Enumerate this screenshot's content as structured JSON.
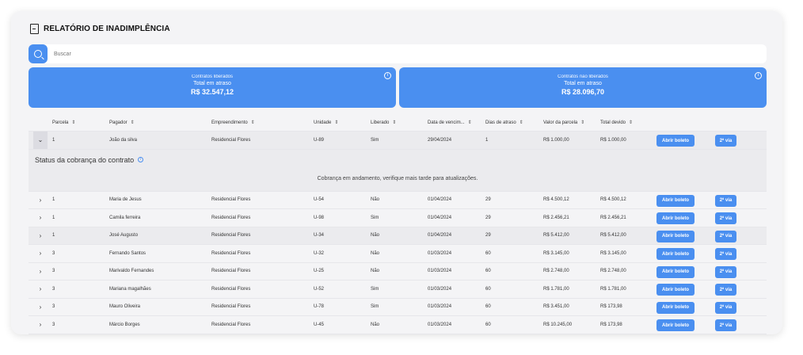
{
  "header": {
    "title": "RELATÓRIO DE INADIMPLÊNCIA",
    "icon": "document-icon"
  },
  "search": {
    "placeholder": "Buscar"
  },
  "kpis": [
    {
      "label": "Contratos liberados",
      "sublabel": "Total em atraso",
      "value": "R$ 32.547,12"
    },
    {
      "label": "Contratos não liberados",
      "sublabel": "Total em atraso",
      "value": "R$ 28.096,70"
    }
  ],
  "table": {
    "columns": [
      "Parcela",
      "Pagador",
      "Empreendimento",
      "Unidade",
      "Liberado",
      "Data de vencim...",
      "Dias de atraso",
      "Valor da parcela",
      "Total devido"
    ],
    "buttons": {
      "boleto": "Abrir boleto",
      "via": "2ª via"
    },
    "expanded": {
      "parcela": "1",
      "pagador": "João da silva",
      "empreendimento": "Residencial Flores",
      "unidade": "U-89",
      "liberado": "Sim",
      "vencimento": "29/04/2024",
      "dias": "1",
      "valor": "R$ 1.000,00",
      "total": "R$ 1.000,00"
    },
    "status": {
      "title": "Status da cobrança do contrato",
      "message": "Cobrança em andamento, verifique mais tarde para atualizações."
    },
    "rows": [
      {
        "parcela": "1",
        "pagador": "Maria de Jesus",
        "empreendimento": "Residencial Flores",
        "unidade": "U-54",
        "liberado": "Não",
        "vencimento": "01/04/2024",
        "dias": "29",
        "valor": "R$ 4.500,12",
        "total": "R$ 4.500,12"
      },
      {
        "parcela": "1",
        "pagador": "Camila ferreira",
        "empreendimento": "Residencial Flores",
        "unidade": "U-98",
        "liberado": "Sim",
        "vencimento": "01/04/2024",
        "dias": "29",
        "valor": "R$ 2.456,21",
        "total": "R$ 2.456,21"
      },
      {
        "parcela": "1",
        "pagador": "José Augusto",
        "empreendimento": "Residencial Flores",
        "unidade": "U-34",
        "liberado": "Não",
        "vencimento": "01/04/2024",
        "dias": "29",
        "valor": "R$ 5.412,00",
        "total": "R$ 5.412,00"
      },
      {
        "parcela": "3",
        "pagador": "Fernando Santos",
        "empreendimento": "Residencial Flores",
        "unidade": "U-32",
        "liberado": "Não",
        "vencimento": "01/03/2024",
        "dias": "60",
        "valor": "R$ 3.145,00",
        "total": "R$ 3.145,00"
      },
      {
        "parcela": "3",
        "pagador": "Marivaldo Fernandes",
        "empreendimento": "Residencial Flores",
        "unidade": "U-25",
        "liberado": "Não",
        "vencimento": "01/03/2024",
        "dias": "60",
        "valor": "R$ 2.748,00",
        "total": "R$ 2.748,00"
      },
      {
        "parcela": "3",
        "pagador": "Mariana magalhães",
        "empreendimento": "Residencial Flores",
        "unidade": "U-52",
        "liberado": "Sim",
        "vencimento": "01/03/2024",
        "dias": "60",
        "valor": "R$ 1.781,00",
        "total": "R$ 1.781,00"
      },
      {
        "parcela": "3",
        "pagador": "Mauro Oliveira",
        "empreendimento": "Residencial Flores",
        "unidade": "U-78",
        "liberado": "Sim",
        "vencimento": "01/03/2024",
        "dias": "60",
        "valor": "R$ 3.451,00",
        "total": "R$ 173,98"
      },
      {
        "parcela": "3",
        "pagador": "Márcio Borges",
        "empreendimento": "Residencial Flores",
        "unidade": "U-45",
        "liberado": "Não",
        "vencimento": "01/03/2024",
        "dias": "60",
        "valor": "R$ 10.245,00",
        "total": "R$ 173,98"
      }
    ]
  }
}
